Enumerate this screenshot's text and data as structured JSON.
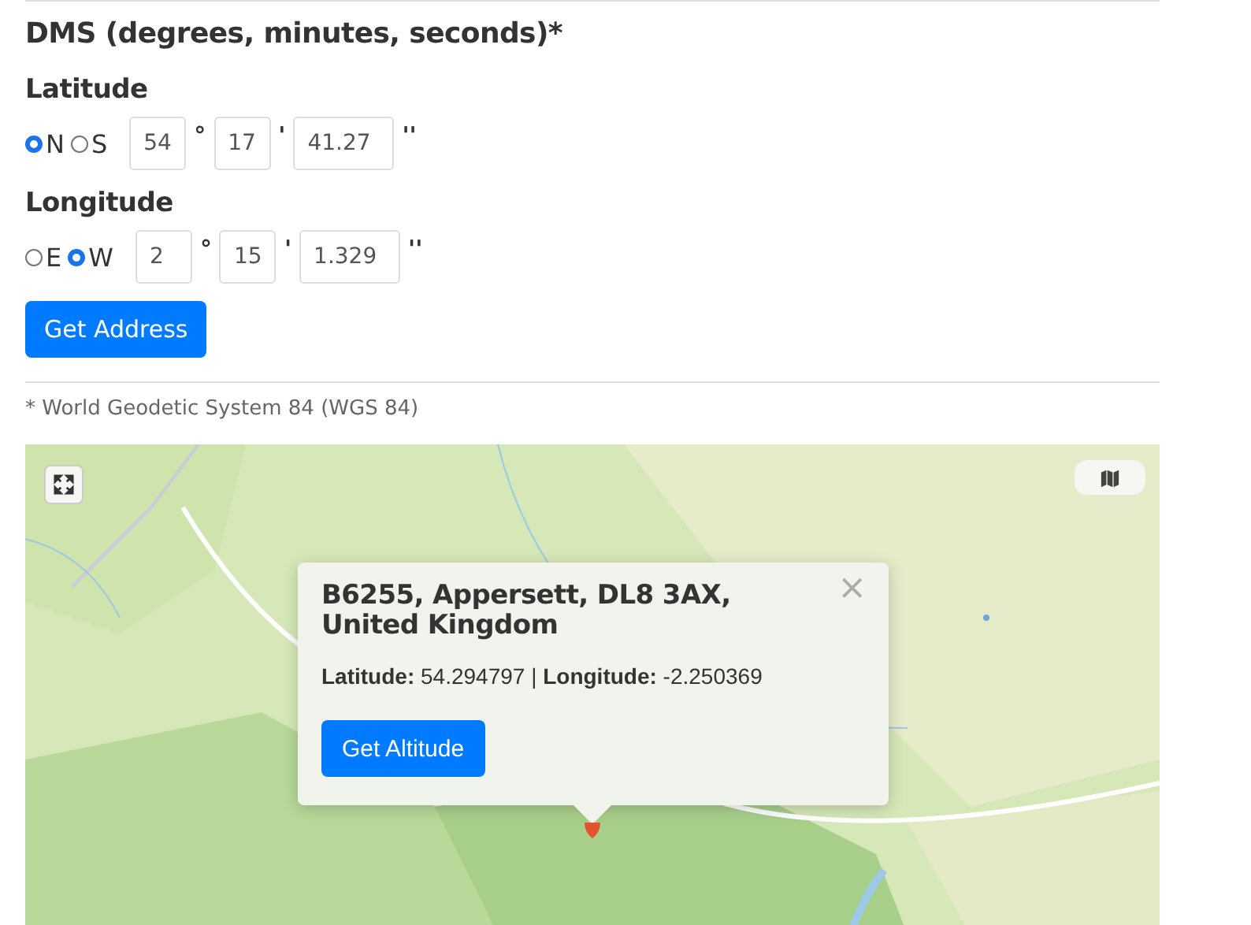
{
  "heading": "DMS (degrees, minutes, seconds)*",
  "coordinates": [
    {
      "label": "Latitude",
      "options": [
        {
          "label": "N",
          "selected": true
        },
        {
          "label": "S",
          "selected": false
        }
      ],
      "degrees": "54",
      "minutes": "17",
      "seconds": "41.27"
    },
    {
      "label": "Longitude",
      "options": [
        {
          "label": "E",
          "selected": false
        },
        {
          "label": "W",
          "selected": true
        }
      ],
      "degrees": "2",
      "minutes": "15",
      "seconds": "1.329"
    }
  ],
  "units": {
    "degrees": "°",
    "minutes": "'",
    "seconds": "''"
  },
  "button": "Get Address",
  "footnote": "* World Geodetic System 84 (WGS 84)",
  "map": {
    "popup": {
      "title": "B6255, Appersett, DL8 3AX, United Kingdom",
      "close": "×",
      "text": "**Latitude:** 54.294797 | **Longitude:** -2.250369",
      "button": "Get Altitude"
    }
  }
}
